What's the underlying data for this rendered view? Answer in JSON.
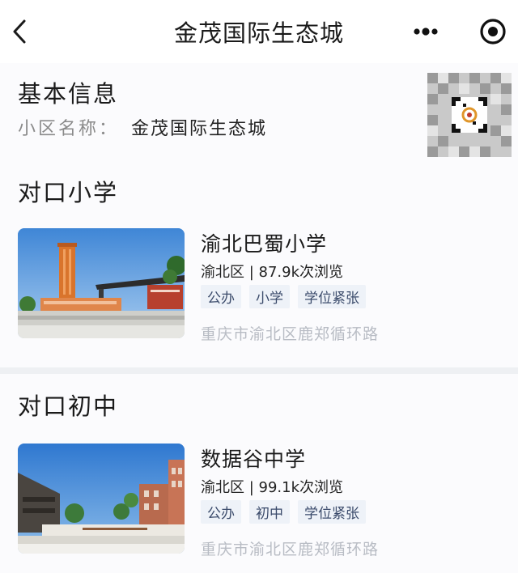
{
  "nav": {
    "title": "金茂国际生态城",
    "icons": [
      "chevron-left-icon",
      "more-dots-icon",
      "target-icon"
    ]
  },
  "basic": {
    "title": "基本信息",
    "community_label": "小区名称：",
    "community_value": "金茂国际生态城",
    "qr": "qr-code-thumbnail"
  },
  "primary": {
    "title": "对口小学",
    "school": {
      "name": "渝北巴蜀小学",
      "meta": "渝北区 | 87.9k次浏览",
      "tags": [
        "公办",
        "小学",
        "学位紧张"
      ],
      "address": "重庆市渝北区鹿郑循环路"
    }
  },
  "middle": {
    "title": "对口初中",
    "school": {
      "name": "数据谷中学",
      "meta": "渝北区 | 99.1k次浏览",
      "tags": [
        "公办",
        "初中",
        "学位紧张"
      ],
      "address": "重庆市渝北区鹿郑循环路"
    }
  },
  "colors": {
    "tag_bg": "#eef2f8",
    "tag_text": "#3b4b6b",
    "address_gray": "#b8bcc4",
    "label_gray": "#8a8a8a"
  }
}
